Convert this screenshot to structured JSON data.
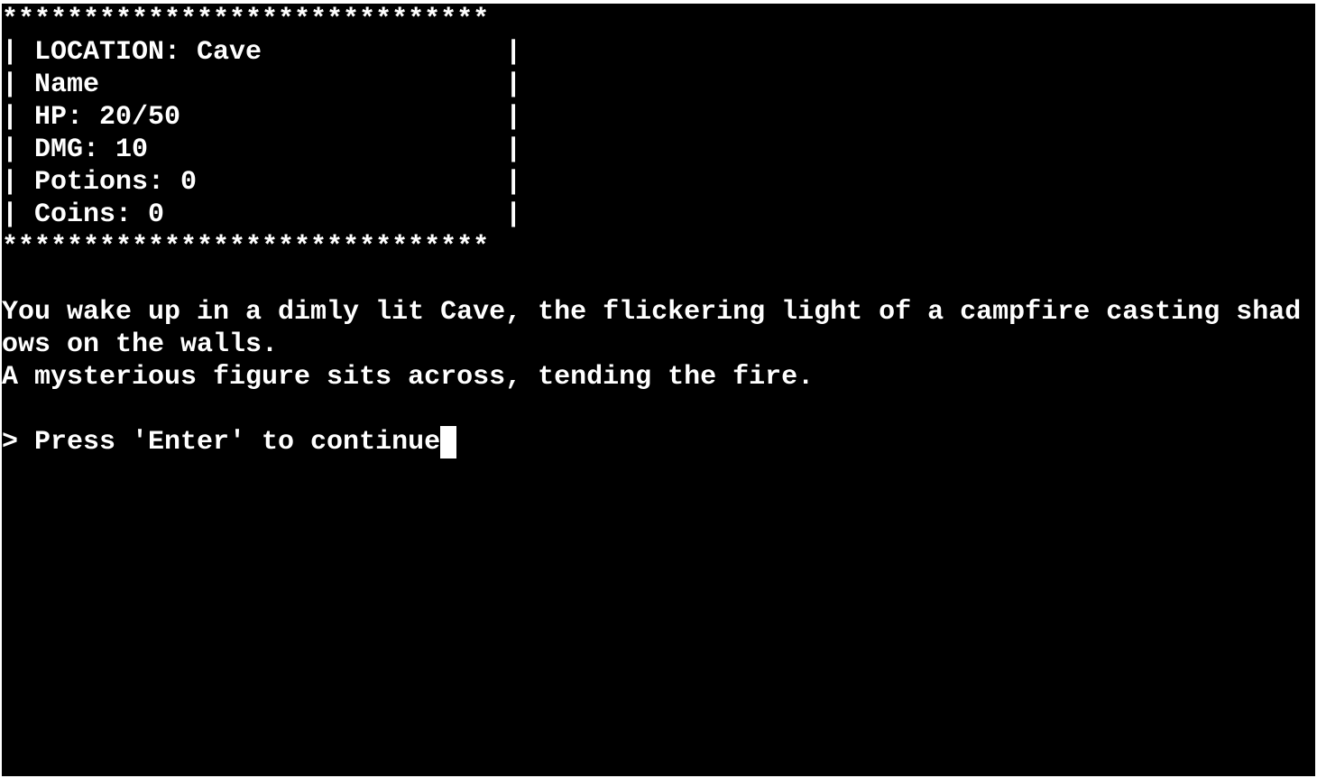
{
  "status_box": {
    "border": "******************************",
    "location": "| LOCATION: Cave               |",
    "name": "| Name                         |",
    "hp": "| HP: 20/50                    |",
    "dmg": "| DMG: 10                      |",
    "potions": "| Potions: 0                   |",
    "coins": "| Coins: 0                     |"
  },
  "narrative": {
    "line1": "You wake up in a dimly lit Cave, the flickering light of a campfire casting shad",
    "line2": "ows on the walls.",
    "line3": "A mysterious figure sits across, tending the fire."
  },
  "prompt": {
    "text": "> Press 'Enter' to continue"
  },
  "colors": {
    "background": "#000000",
    "foreground": "#ffffff"
  }
}
